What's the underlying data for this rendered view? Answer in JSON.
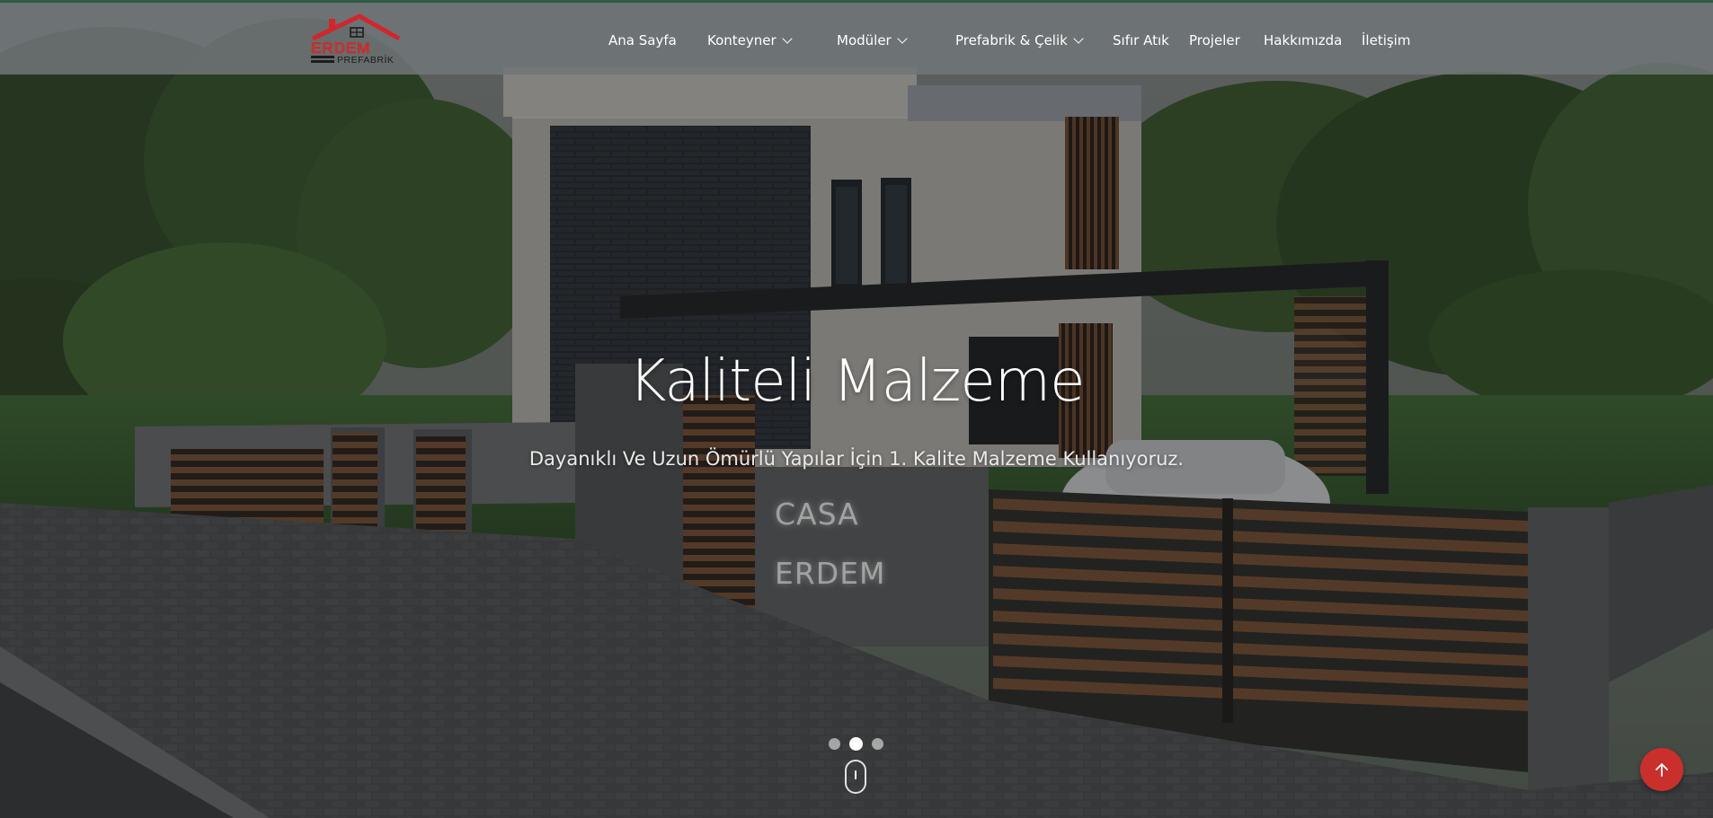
{
  "brand": {
    "logo_name": "ERDEM",
    "logo_sub": "PREFABRİK",
    "logo_color": "#d1262b",
    "logo_dark": "#1c1c1c"
  },
  "nav": {
    "items": [
      {
        "label": "Ana Sayfa",
        "has_dropdown": false
      },
      {
        "label": "Konteyner",
        "has_dropdown": true
      },
      {
        "label": "Modüler",
        "has_dropdown": true
      },
      {
        "label": "Prefabrik & Çelik",
        "has_dropdown": true
      },
      {
        "label": "Sıfır Atık",
        "has_dropdown": false
      },
      {
        "label": "Projeler",
        "has_dropdown": false
      },
      {
        "label": "Hakkımızda",
        "has_dropdown": false
      },
      {
        "label": "İletişim",
        "has_dropdown": false
      }
    ]
  },
  "hero": {
    "title": "Kaliteli Malzeme",
    "subtitle": "Dayanıklı Ve Uzun Ömürlü Yapılar İçin 1. Kalite Malzeme Kullanıyoruz.",
    "sign_line1": "CASA",
    "sign_line2": "ERDEM",
    "slides_total": 3,
    "active_slide": 2
  },
  "colors": {
    "header_border": "#2f5a45",
    "back_to_top": "#c9302c"
  },
  "icons": {
    "dropdown": "chevron-down-icon",
    "scroll": "mouse-scroll-icon",
    "back_to_top": "arrow-up-icon"
  }
}
